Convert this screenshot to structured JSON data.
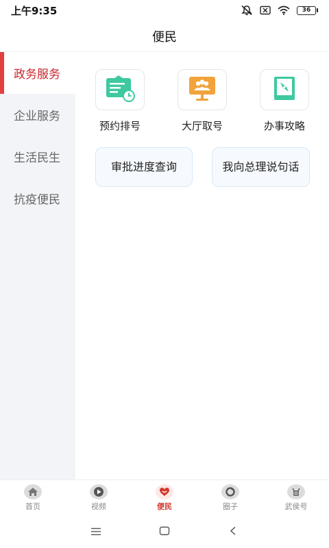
{
  "status": {
    "time": "上午9:35",
    "battery": "36"
  },
  "header": {
    "title": "便民"
  },
  "sidebar": {
    "items": [
      {
        "label": "政务服务",
        "active": true
      },
      {
        "label": "企业服务",
        "active": false
      },
      {
        "label": "生活民生",
        "active": false
      },
      {
        "label": "抗疫便民",
        "active": false
      }
    ]
  },
  "main": {
    "grid": [
      {
        "label": "预约排号",
        "icon": "appointment-card-icon"
      },
      {
        "label": "大厅取号",
        "icon": "hall-ticket-icon"
      },
      {
        "label": "办事攻略",
        "icon": "guide-compass-icon"
      }
    ],
    "pills": [
      {
        "label": "审批进度查询"
      },
      {
        "label": "我向总理说句话"
      }
    ]
  },
  "tabbar": {
    "items": [
      {
        "label": "首页",
        "icon": "home-icon"
      },
      {
        "label": "视频",
        "icon": "video-play-icon"
      },
      {
        "label": "便民",
        "icon": "heart-icon",
        "active": true
      },
      {
        "label": "圈子",
        "icon": "circle-icon"
      },
      {
        "label": "武侯号",
        "icon": "wuhou-icon"
      }
    ]
  },
  "colors": {
    "accent": "#c9252c",
    "sidebar_bg": "#f2f4f7",
    "green": "#3ec9a0",
    "orange": "#f2a33a"
  }
}
